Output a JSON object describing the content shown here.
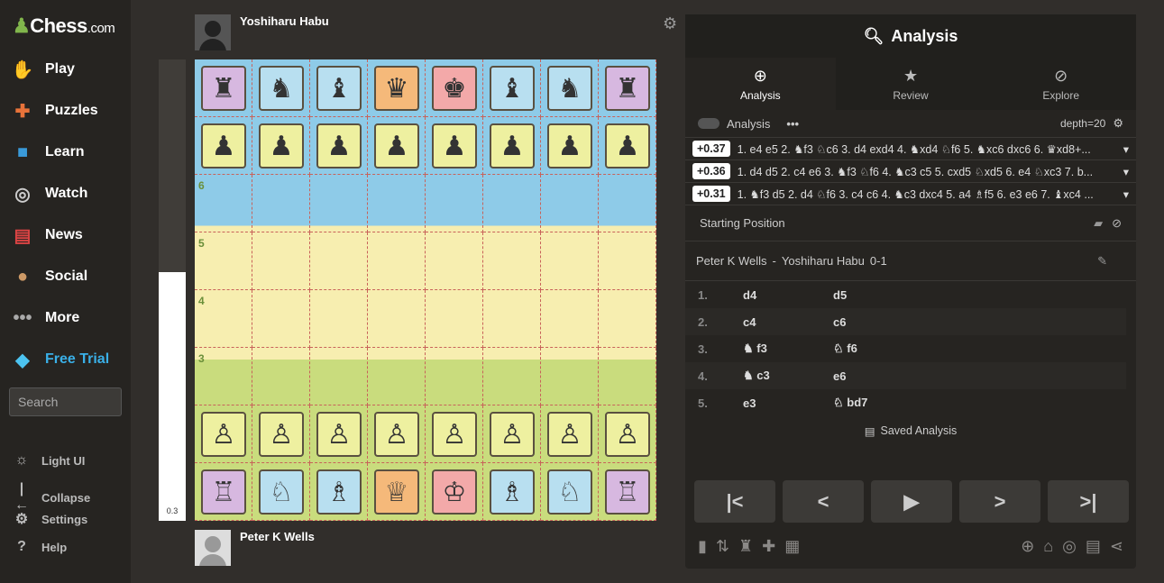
{
  "sidebar": {
    "logo": "Chess",
    "logo_suffix": ".com",
    "items": [
      {
        "label": "Play",
        "icon": "play-icon"
      },
      {
        "label": "Puzzles",
        "icon": "puzzle-icon"
      },
      {
        "label": "Learn",
        "icon": "learn-icon"
      },
      {
        "label": "Watch",
        "icon": "binoculars-icon"
      },
      {
        "label": "News",
        "icon": "news-icon"
      },
      {
        "label": "Social",
        "icon": "social-icon"
      },
      {
        "label": "More",
        "icon": "more-icon"
      },
      {
        "label": "Free Trial",
        "icon": "diamond-icon"
      }
    ],
    "search_placeholder": "Search",
    "footer": [
      {
        "label": "Light UI"
      },
      {
        "label": "Collapse"
      },
      {
        "label": "Settings"
      },
      {
        "label": "Help"
      }
    ]
  },
  "players": {
    "top": "Yoshiharu Habu",
    "bottom": "Peter K Wells"
  },
  "eval": {
    "value": "0.3",
    "white_fraction": 0.54
  },
  "board": {
    "rank_labels": [
      "6",
      "5",
      "4",
      "3"
    ]
  },
  "panel": {
    "title": "Analysis",
    "tabs": [
      {
        "label": "Analysis"
      },
      {
        "label": "Review"
      },
      {
        "label": "Explore"
      }
    ],
    "analysis_toggle": "Analysis",
    "depth": "depth=20",
    "lines": [
      {
        "score": "+0.37",
        "moves": "1. e4 e5 2. ♞f3 ♘c6 3. d4 exd4 4. ♞xd4 ♘f6 5. ♞xc6 dxc6 6. ♛xd8+..."
      },
      {
        "score": "+0.36",
        "moves": "1. d4 d5 2. c4 e6 3. ♞f3 ♘f6 4. ♞c3 c5 5. cxd5 ♘xd5 6. e4 ♘xc3 7. b..."
      },
      {
        "score": "+0.31",
        "moves": "1. ♞f3 d5 2. d4 ♘f6 3. c4 c6 4. ♞c3 dxc4 5. a4 ♗f5 6. e3 e6 7. ♝xc4 ..."
      }
    ],
    "opening": "Starting Position",
    "game": {
      "white": "Peter K Wells",
      "sep": "-",
      "black": "Yoshiharu Habu",
      "result": "0-1"
    },
    "moves": [
      {
        "n": "1.",
        "w": "d4",
        "b": "d5"
      },
      {
        "n": "2.",
        "w": "c4",
        "b": "c6"
      },
      {
        "n": "3.",
        "w": "♞ f3",
        "b": "♘ f6"
      },
      {
        "n": "4.",
        "w": "♞ c3",
        "b": "e6"
      },
      {
        "n": "5.",
        "w": "e3",
        "b": "♘ bd7"
      }
    ],
    "saved": "Saved Analysis"
  }
}
